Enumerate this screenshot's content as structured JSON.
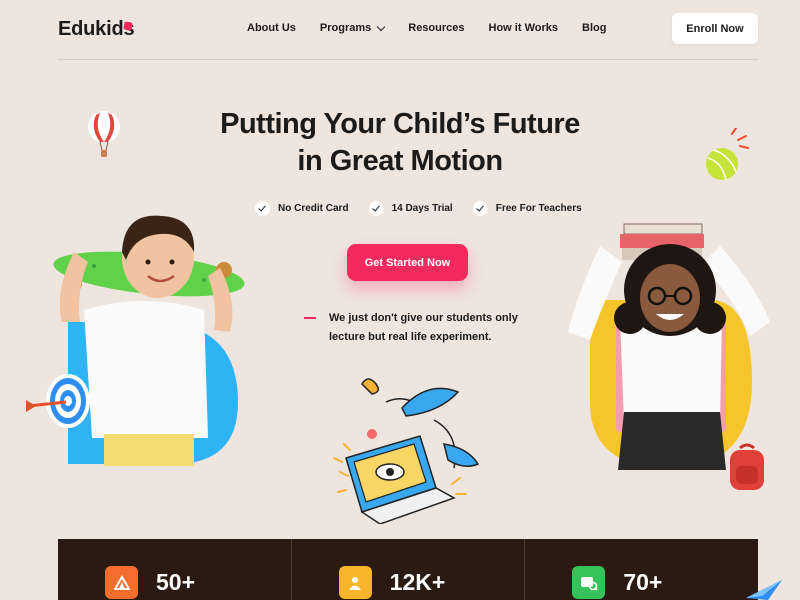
{
  "brand": {
    "name": "Edukids",
    "accent": "#f2275b"
  },
  "nav": {
    "items": [
      {
        "label": "About Us"
      },
      {
        "label": "Programs",
        "has_dropdown": true
      },
      {
        "label": "Resources"
      },
      {
        "label": "How it Works"
      },
      {
        "label": "Blog"
      }
    ],
    "enroll_label": "Enroll Now"
  },
  "hero": {
    "headline_line1": "Putting Your Child’s Future",
    "headline_line2": "in Great Motion",
    "checks": [
      "No Credit Card",
      "14 Days Trial",
      "Free For Teachers"
    ],
    "cta_label": "Get Started Now",
    "tagline_line1": "We just don't give our students only",
    "tagline_line2": "lecture but real life experiment."
  },
  "stats": [
    {
      "value": "50+",
      "icon": "tent-icon",
      "color": "#f56d2d"
    },
    {
      "value": "12K+",
      "icon": "user-icon",
      "color": "#f7b52b"
    },
    {
      "value": "70+",
      "icon": "course-icon",
      "color": "#38c25a"
    }
  ]
}
